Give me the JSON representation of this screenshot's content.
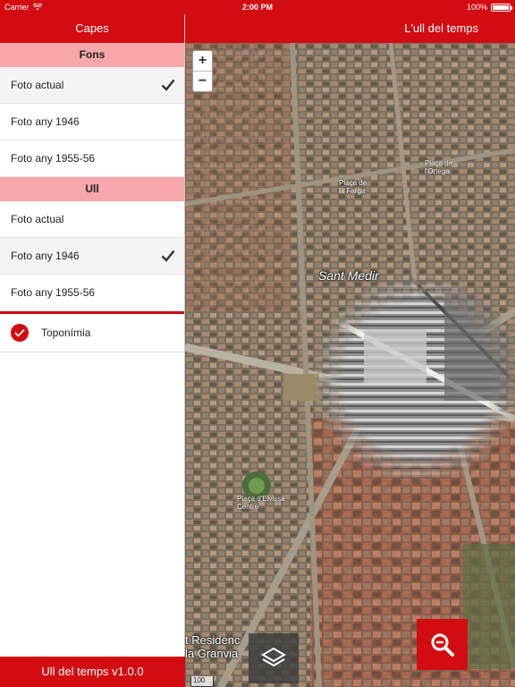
{
  "status_bar": {
    "carrier": "Carrier",
    "time": "2:00 PM",
    "battery": "100%"
  },
  "sidebar": {
    "title": "Capes",
    "sections": [
      {
        "title": "Fons",
        "items": [
          {
            "label": "Foto actual",
            "selected": true
          },
          {
            "label": "Foto any 1946",
            "selected": false
          },
          {
            "label": "Foto any 1955-56",
            "selected": false
          }
        ]
      },
      {
        "title": "Ull",
        "items": [
          {
            "label": "Foto actual",
            "selected": false
          },
          {
            "label": "Foto any 1946",
            "selected": true
          },
          {
            "label": "Foto any 1955-56",
            "selected": false
          }
        ]
      }
    ],
    "toponimia": {
      "label": "Toponímia",
      "checked": true
    },
    "footer": "Ull del temps v1.0.0"
  },
  "map": {
    "title": "L'ull del temps",
    "zoom_in": "+",
    "zoom_out": "−",
    "labels": {
      "sant_medir": "Sant Medir",
      "placa_farga": "Plaça de\nla Farga",
      "placa_ortega": "Plaça de\nl'Ortega",
      "placa_ibiza": "Plaça d'Eivissa\nCentre",
      "residencial": "t Residenc\nla Granvia"
    },
    "scale": "100 m"
  },
  "colors": {
    "accent": "#d30c12",
    "section_header": "#f7a6a9"
  },
  "icons": {
    "wifi": "wifi-icon",
    "check": "checkmark-icon",
    "layers": "layers-icon",
    "search": "zoom-search-icon"
  }
}
